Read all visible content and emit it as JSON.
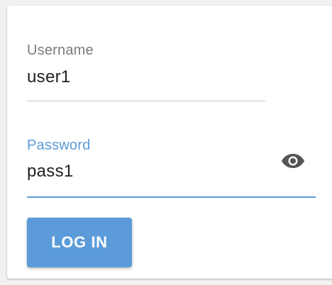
{
  "form": {
    "username": {
      "label": "Username",
      "value": "user1"
    },
    "password": {
      "label": "Password",
      "value": "pass1",
      "toggle_icon": "eye-icon"
    },
    "submit_label": "LOG IN"
  },
  "colors": {
    "accent": "#5b9bd9",
    "label_inactive": "#7a7a7a",
    "underline_inactive": "#c8c8c8",
    "eye_icon": "#555555",
    "button_bg": "#5b9bd9"
  }
}
